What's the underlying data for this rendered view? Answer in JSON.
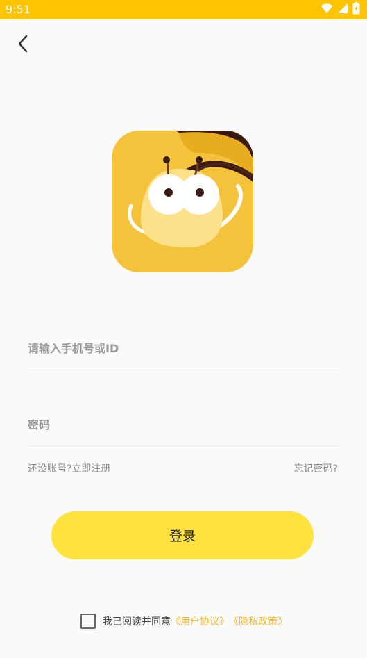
{
  "status_bar": {
    "time": "9:51",
    "icons": [
      "wifi-icon",
      "cellular-signal-icon",
      "battery-charging-icon"
    ],
    "background": "#ffc400"
  },
  "nav": {
    "back_icon": "chevron-left-icon"
  },
  "logo": {
    "icon": "app-logo-icon",
    "background": "#f5c33b"
  },
  "form": {
    "phone_placeholder": "请输入手机号或ID",
    "password_placeholder": "密码",
    "register_link": "还没账号?立即注册",
    "forgot_link": "忘记密码?"
  },
  "login_button": {
    "label": "登录",
    "background": "#ffe23e"
  },
  "agreement": {
    "checked": false,
    "prefix": "我已阅读并同意",
    "user_agreement": "《用户协议》",
    "privacy_policy": "《隐私政策》",
    "link_color": "#f0b82b"
  }
}
